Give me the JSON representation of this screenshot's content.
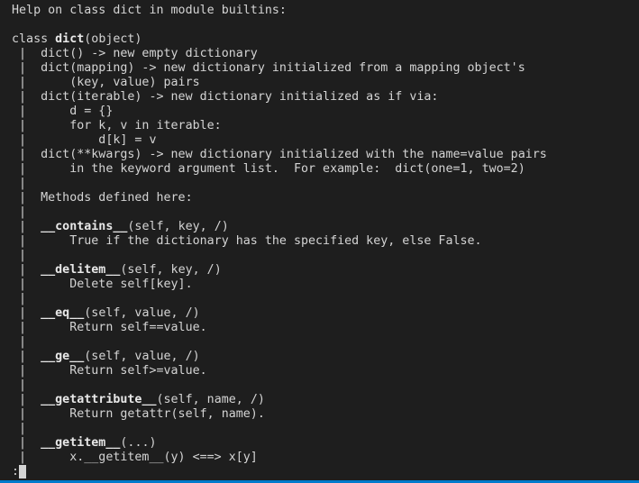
{
  "terminal": {
    "lines": [
      [
        {
          "t": "Help on class dict in module builtins:"
        }
      ],
      [
        {
          "t": ""
        }
      ],
      [
        {
          "t": "class "
        },
        {
          "t": "dict",
          "b": true
        },
        {
          "t": "(object)"
        }
      ],
      [
        {
          "t": " |  dict() -> new empty dictionary"
        }
      ],
      [
        {
          "t": " |  dict(mapping) -> new dictionary initialized from a mapping object's"
        }
      ],
      [
        {
          "t": " |      (key, value) pairs"
        }
      ],
      [
        {
          "t": " |  dict(iterable) -> new dictionary initialized as if via:"
        }
      ],
      [
        {
          "t": " |      d = {}"
        }
      ],
      [
        {
          "t": " |      for k, v in iterable:"
        }
      ],
      [
        {
          "t": " |          d[k] = v"
        }
      ],
      [
        {
          "t": " |  dict(**kwargs) -> new dictionary initialized with the name=value pairs"
        }
      ],
      [
        {
          "t": " |      in the keyword argument list.  For example:  dict(one=1, two=2)"
        }
      ],
      [
        {
          "t": " |"
        }
      ],
      [
        {
          "t": " |  Methods defined here:"
        }
      ],
      [
        {
          "t": " |"
        }
      ],
      [
        {
          "t": " |  "
        },
        {
          "t": "__contains__",
          "b": true
        },
        {
          "t": "(self, key, /)"
        }
      ],
      [
        {
          "t": " |      True if the dictionary has the specified key, else False."
        }
      ],
      [
        {
          "t": " |"
        }
      ],
      [
        {
          "t": " |  "
        },
        {
          "t": "__delitem__",
          "b": true
        },
        {
          "t": "(self, key, /)"
        }
      ],
      [
        {
          "t": " |      Delete self[key]."
        }
      ],
      [
        {
          "t": " |"
        }
      ],
      [
        {
          "t": " |  "
        },
        {
          "t": "__eq__",
          "b": true
        },
        {
          "t": "(self, value, /)"
        }
      ],
      [
        {
          "t": " |      Return self==value."
        }
      ],
      [
        {
          "t": " |"
        }
      ],
      [
        {
          "t": " |  "
        },
        {
          "t": "__ge__",
          "b": true
        },
        {
          "t": "(self, value, /)"
        }
      ],
      [
        {
          "t": " |      Return self>=value."
        }
      ],
      [
        {
          "t": " |"
        }
      ],
      [
        {
          "t": " |  "
        },
        {
          "t": "__getattribute__",
          "b": true
        },
        {
          "t": "(self, name, /)"
        }
      ],
      [
        {
          "t": " |      Return getattr(self, name)."
        }
      ],
      [
        {
          "t": " |"
        }
      ],
      [
        {
          "t": " |  "
        },
        {
          "t": "__getitem__",
          "b": true
        },
        {
          "t": "(...)"
        }
      ],
      [
        {
          "t": " |      x.__getitem__(y) <==> x[y]"
        }
      ]
    ],
    "prompt": ":"
  },
  "colors": {
    "background": "#1e1e1e",
    "text": "#d4d4d4",
    "bold_text": "#e8e8e8",
    "status_border": "#007acc"
  }
}
